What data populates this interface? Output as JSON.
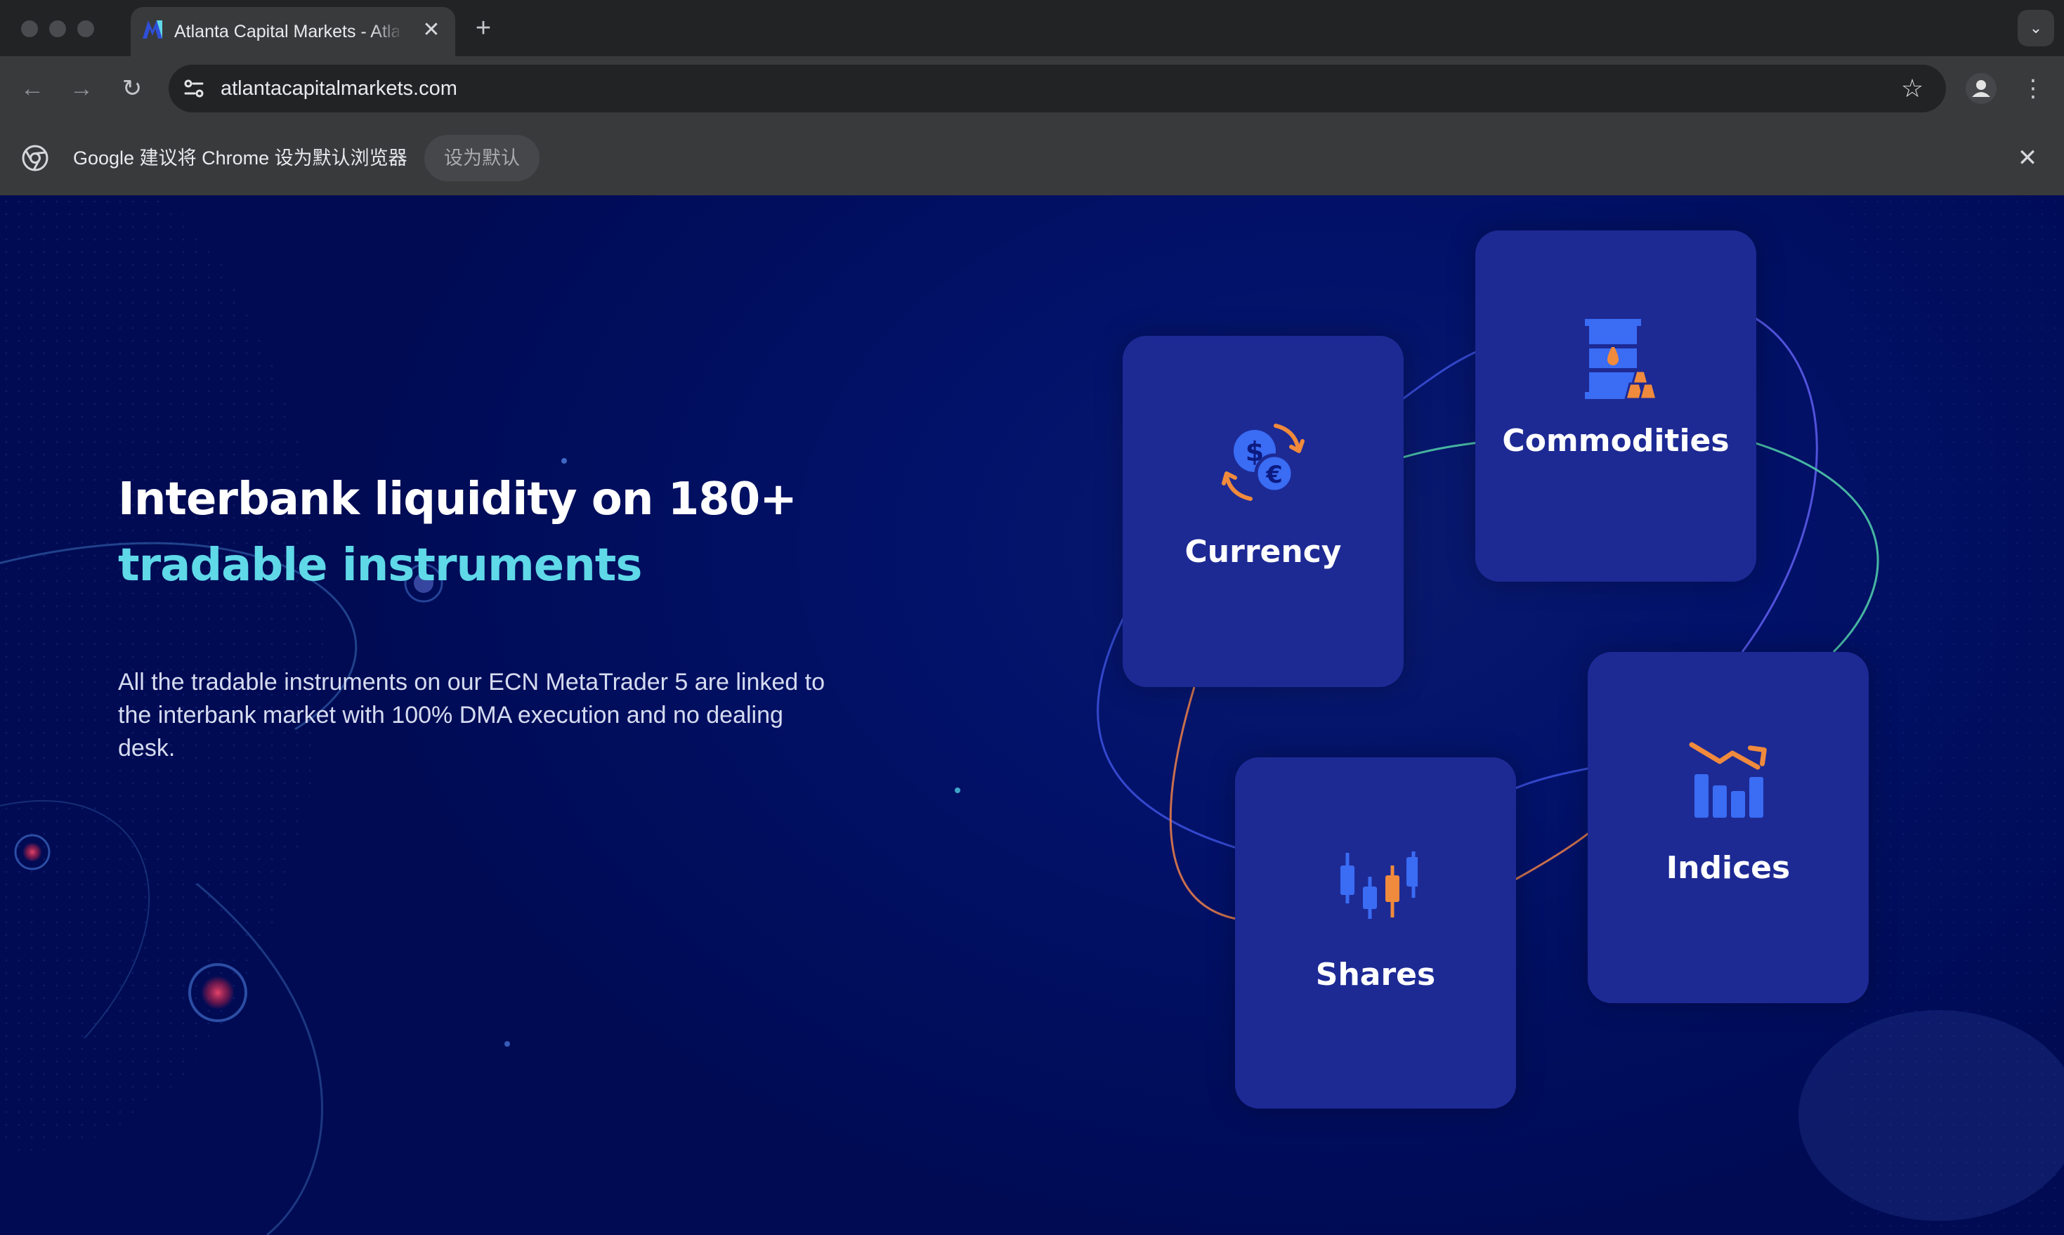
{
  "browser": {
    "tab": {
      "title": "Atlanta Capital Markets - Atla",
      "close_glyph": "✕"
    },
    "new_tab_glyph": "+",
    "tab_search_glyph": "⌄",
    "url": "atlantacapitalmarkets.com",
    "nav": {
      "back": "←",
      "forward": "→",
      "reload": "↻"
    },
    "star_glyph": "☆",
    "menu_glyph": "⋮",
    "infobar": {
      "message": "Google 建议将 Chrome 设为默认浏览器",
      "button": "设为默认",
      "close_glyph": "✕"
    }
  },
  "hero": {
    "title_line1": "Interbank liquidity on 180+",
    "title_line2": "tradable instruments",
    "description": "All the tradable instruments on our ECN MetaTrader 5 are linked to the interbank market with 100% DMA execution and no dealing desk."
  },
  "instruments": [
    {
      "label": "Currency",
      "icon": "currency-exchange-icon"
    },
    {
      "label": "Commodities",
      "icon": "oil-barrel-gold-icon"
    },
    {
      "label": "Indices",
      "icon": "bar-chart-trend-icon"
    },
    {
      "label": "Shares",
      "icon": "candlestick-icon"
    }
  ],
  "colors": {
    "page_bg": "#000b54",
    "card_bg": "#1d2a94",
    "title_accent": "#5fd8e8",
    "icon_blue": "#3a6cf4",
    "icon_orange": "#f08a3c"
  }
}
